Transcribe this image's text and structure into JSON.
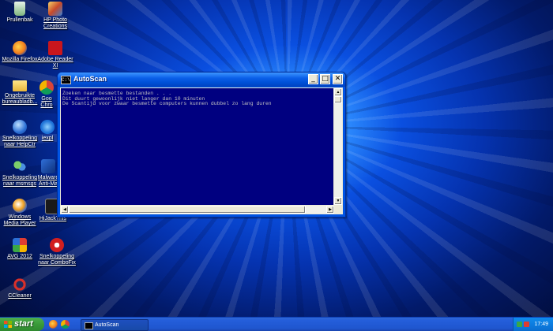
{
  "desktop": {
    "icons": [
      {
        "name": "recycle-bin-icon",
        "label": "Prullenbak"
      },
      {
        "name": "hp-photo-creations-icon",
        "label": "HP Photo Creations"
      },
      {
        "name": "mozilla-firefox-icon",
        "label": "Mozilla Firefox"
      },
      {
        "name": "adobe-reader-icon",
        "label": "Adobe Reader XI"
      },
      {
        "name": "unused-shortcuts-folder-icon",
        "label": "Ongebruikte bureaubladb..."
      },
      {
        "name": "google-chrome-icon",
        "label": "Goo Chro"
      },
      {
        "name": "helpctr-shortcut-icon",
        "label": "Snelkoppeling naar HelpCtr"
      },
      {
        "name": "internet-explorer-icon",
        "label": "iexpl"
      },
      {
        "name": "msmsgs-shortcut-icon",
        "label": "Snelkoppeling naar msmsgs"
      },
      {
        "name": "malwarebytes-icon",
        "label": "Malware Anti-Ma"
      },
      {
        "name": "windows-media-player-icon",
        "label": "Windows Media Player"
      },
      {
        "name": "hijackthis-icon",
        "label": "HiJackThis"
      },
      {
        "name": "avg-2012-icon",
        "label": "AVG 2012"
      },
      {
        "name": "combofix-shortcut-icon",
        "label": "Snelkoppeling naar ComboFix"
      },
      {
        "name": "ccleaner-icon",
        "label": "CCleaner"
      }
    ]
  },
  "window": {
    "title": "AutoScan",
    "title_icon_text": "C:\\",
    "minimize": "_",
    "maximize": "□",
    "close": "✕",
    "console_lines": [
      "Zoeken naar besmette bestanden . . .",
      "Dit duurt gewoonlijk niet langer dan 10 minuten",
      "De Scantijd voor zwaar besmette computers kunnen dubbel zo lang duren"
    ]
  },
  "taskbar": {
    "start_label": "start",
    "task_label": "AutoScan",
    "clock": "17:49"
  },
  "colors": {
    "console_bg": "#000080",
    "console_text": "#c0c0c0",
    "taskbar_blue": "#245edb",
    "start_green": "#3a9a3a"
  }
}
